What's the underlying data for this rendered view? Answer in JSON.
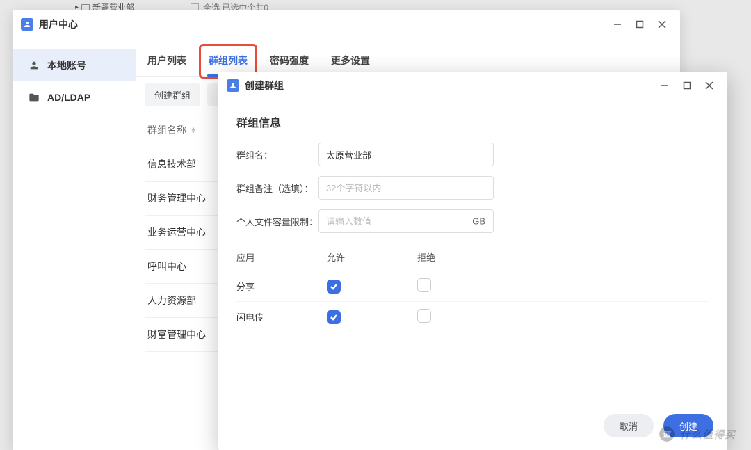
{
  "background": {
    "tree_item": "新疆营业部",
    "checkbox_label": "全选  已选中个共0"
  },
  "main_window": {
    "title": "用户中心",
    "sidebar": {
      "items": [
        {
          "label": "本地账号",
          "active": true,
          "icon": "user"
        },
        {
          "label": "AD/LDAP",
          "active": false,
          "icon": "folder"
        }
      ]
    },
    "tabs": [
      {
        "label": "用户列表"
      },
      {
        "label": "群组列表"
      },
      {
        "label": "密码强度"
      },
      {
        "label": "更多设置"
      }
    ],
    "toolbar": {
      "create_group": "创建群组",
      "delete_partial": "删"
    },
    "list": {
      "header": "群组名称",
      "rows": [
        "信息技术部",
        "财务管理中心",
        "业务运营中心",
        "呼叫中心",
        "人力资源部",
        "财富管理中心"
      ]
    }
  },
  "modal": {
    "title": "创建群组",
    "section_title": "群组信息",
    "fields": {
      "name_label": "群组名：",
      "name_value": "太原营业部",
      "remark_label": "群组备注（选填）：",
      "remark_placeholder": "32个字符以内",
      "quota_label": "个人文件容量限制：",
      "quota_placeholder": "请输入数值",
      "quota_unit": "GB"
    },
    "perm_table": {
      "headers": {
        "app": "应用",
        "allow": "允许",
        "deny": "拒绝"
      },
      "rows": [
        {
          "app": "分享",
          "allow": true,
          "deny": false
        },
        {
          "app": "闪电传",
          "allow": true,
          "deny": false
        }
      ]
    },
    "footer": {
      "cancel": "取消",
      "create": "创建"
    }
  },
  "watermark": "什么值得买"
}
